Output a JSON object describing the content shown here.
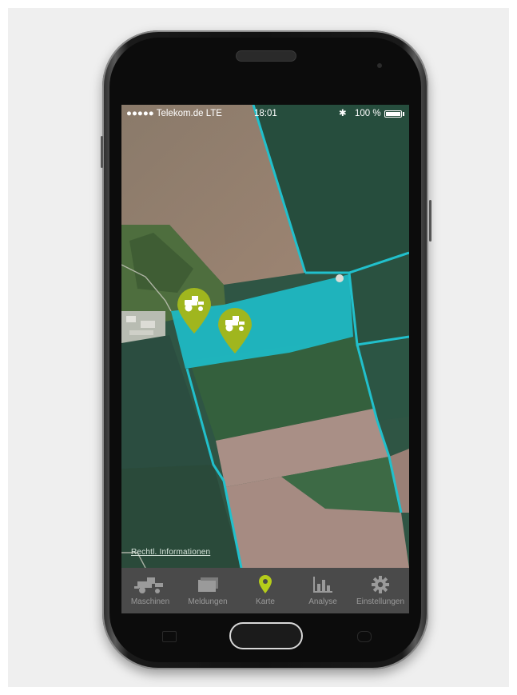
{
  "statusbar": {
    "carrier": "●●●●● Telekom.de  LTE",
    "time": "18:01",
    "battery": "100 %"
  },
  "map": {
    "legal_link": "Rechtl. Informationen",
    "field_highlight_color": "#1fb8c3",
    "pin_color": "#a0b61e",
    "markers": [
      {
        "name": "tractor-marker-1",
        "icon": "tractor-icon"
      },
      {
        "name": "tractor-marker-2",
        "icon": "tractor-icon"
      }
    ]
  },
  "tabbar": {
    "active_color": "#b5cc1b",
    "inactive_color": "#9a9a9a",
    "items": [
      {
        "label": "Maschinen",
        "icon": "harvester-icon"
      },
      {
        "label": "Meldungen",
        "icon": "messages-icon"
      },
      {
        "label": "Karte",
        "icon": "map-pin-icon",
        "active": true
      },
      {
        "label": "Analyse",
        "icon": "bar-chart-icon"
      },
      {
        "label": "Einstellungen",
        "icon": "gear-icon"
      }
    ]
  }
}
